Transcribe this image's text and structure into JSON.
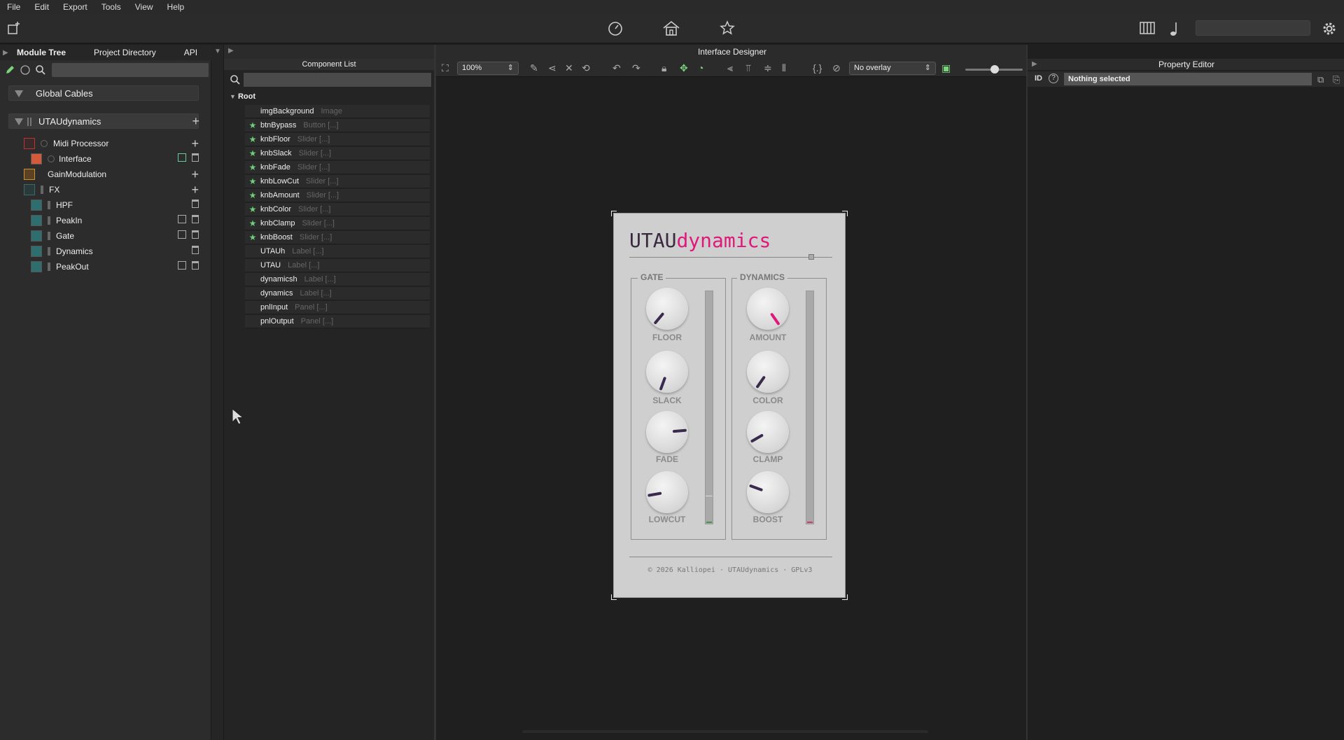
{
  "menu": [
    "File",
    "Edit",
    "Export",
    "Tools",
    "View",
    "Help"
  ],
  "left_tabs": [
    "Module Tree",
    "Project Directory",
    "API"
  ],
  "global_cables": "Global Cables",
  "root_module": "UTAUdynamics",
  "tree": {
    "midi_processor": "Midi Processor",
    "interface": "Interface",
    "gain_modulation": "GainModulation",
    "fx": "FX",
    "fx_items": [
      "HPF",
      "PeakIn",
      "Gate",
      "Dynamics",
      "PeakOut"
    ]
  },
  "component_list": {
    "title": "Component List",
    "root": "Root",
    "items": [
      {
        "name": "imgBackground",
        "type": "Image",
        "starred": false
      },
      {
        "name": "btnBypass",
        "type": "Button [...]",
        "starred": true
      },
      {
        "name": "knbFloor",
        "type": "Slider [...]",
        "starred": true
      },
      {
        "name": "knbSlack",
        "type": "Slider [...]",
        "starred": true
      },
      {
        "name": "knbFade",
        "type": "Slider [...]",
        "starred": true
      },
      {
        "name": "knbLowCut",
        "type": "Slider [...]",
        "starred": true
      },
      {
        "name": "knbAmount",
        "type": "Slider [...]",
        "starred": true
      },
      {
        "name": "knbColor",
        "type": "Slider [...]",
        "starred": true
      },
      {
        "name": "knbClamp",
        "type": "Slider [...]",
        "starred": true
      },
      {
        "name": "knbBoost",
        "type": "Slider [...]",
        "starred": true
      },
      {
        "name": "UTAUh",
        "type": "Label [...]",
        "starred": false
      },
      {
        "name": "UTAU",
        "type": "Label [...]",
        "starred": false
      },
      {
        "name": "dynamicsh",
        "type": "Label [...]",
        "starred": false
      },
      {
        "name": "dynamics",
        "type": "Label [...]",
        "starred": false
      },
      {
        "name": "pnlInput",
        "type": "Panel [...]",
        "starred": false
      },
      {
        "name": "pnlOutput",
        "type": "Panel [...]",
        "starred": false
      }
    ]
  },
  "designer": {
    "title": "Interface Designer",
    "zoom": "100%",
    "overlay": "No overlay"
  },
  "plugin": {
    "title_a": "UTAU",
    "title_b": "dynamics",
    "gate_label": "GATE",
    "dynamics_label": "DYNAMICS",
    "knobs_left": [
      "FLOOR",
      "SLACK",
      "FADE",
      "LOWCUT"
    ],
    "knobs_right": [
      "AMOUNT",
      "COLOR",
      "CLAMP",
      "BOOST"
    ],
    "footer": "© 2026 Kalliopei · UTAUdynamics · GPLv3"
  },
  "property_editor": {
    "title": "Property Editor",
    "id_label": "ID",
    "selection": "Nothing selected"
  },
  "colors": {
    "accent_pink": "#e0187a",
    "title_dark": "#3a2a40",
    "star_green": "#6fcf7c"
  }
}
